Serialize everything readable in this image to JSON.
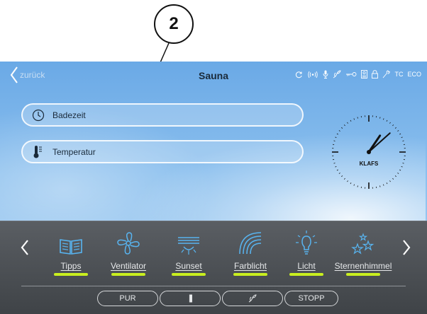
{
  "callout": {
    "number": "2"
  },
  "header": {
    "back_label": "zurück",
    "title": "Sauna",
    "status_tc": "TC",
    "status_eco": "ECO"
  },
  "panels": [
    {
      "label": "Badezeit",
      "icon": "clock-icon"
    },
    {
      "label": "Temperatur",
      "icon": "thermometer-icon"
    }
  ],
  "clock": {
    "brand": "KLAFS",
    "hour": 1,
    "minute": 8
  },
  "functions": [
    {
      "label": "Tipps",
      "icon": "book-icon"
    },
    {
      "label": "Ventilator",
      "icon": "fan-icon"
    },
    {
      "label": "Sunset",
      "icon": "sunset-icon"
    },
    {
      "label": "Farblicht",
      "icon": "rainbow-icon"
    },
    {
      "label": "Licht",
      "icon": "light-bulb-icon"
    },
    {
      "label": "Sternenhimmel",
      "icon": "stars-icon"
    }
  ],
  "buttons": {
    "pur": "PUR",
    "stopp": "STOPP"
  },
  "colors": {
    "accent": "#c9ef1f",
    "icon_blue": "#58b4f0",
    "sky": "#7fb8ea",
    "dock": "#4a4e52"
  }
}
